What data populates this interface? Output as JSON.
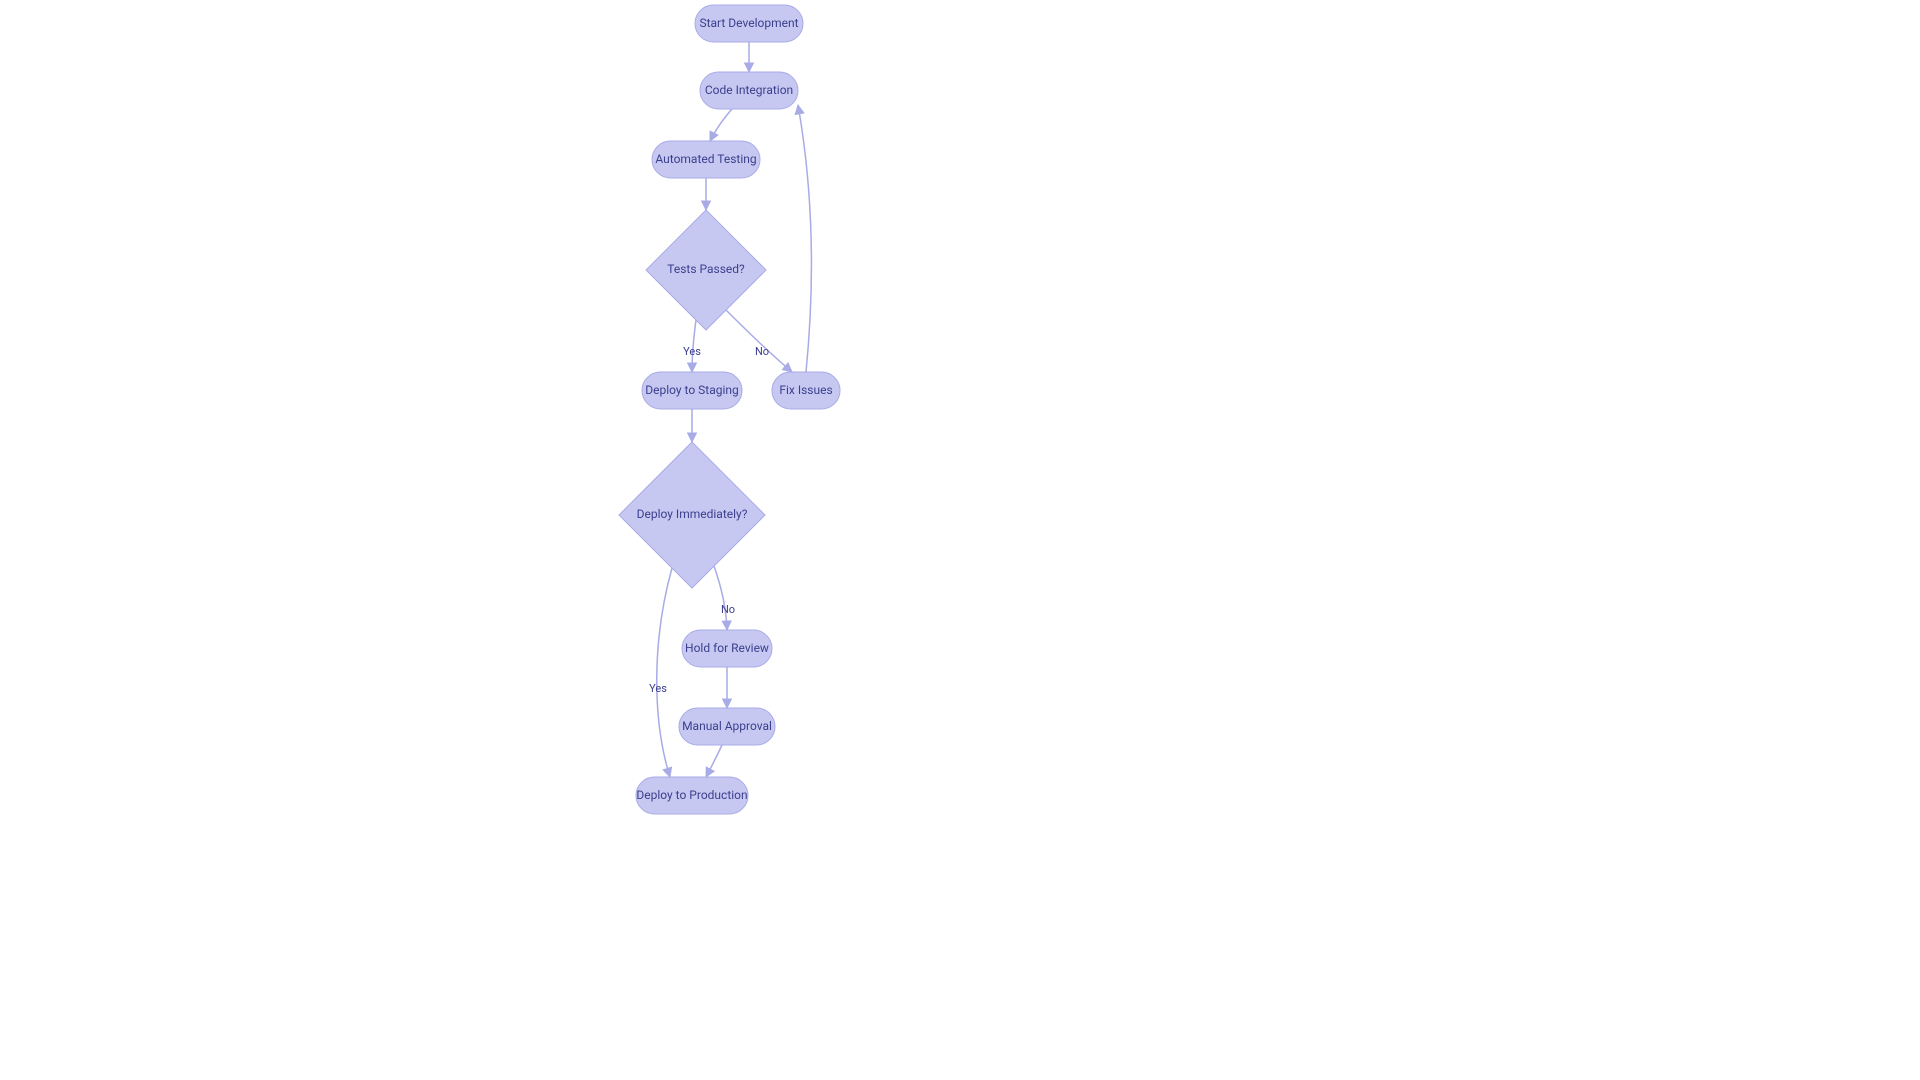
{
  "chart_data": {
    "type": "flowchart",
    "nodes": [
      {
        "id": "start",
        "label": "Start Development",
        "shape": "stadium"
      },
      {
        "id": "integ",
        "label": "Code Integration",
        "shape": "stadium"
      },
      {
        "id": "test",
        "label": "Automated Testing",
        "shape": "stadium"
      },
      {
        "id": "pass",
        "label": "Tests Passed?",
        "shape": "diamond"
      },
      {
        "id": "stage",
        "label": "Deploy to Staging",
        "shape": "stadium"
      },
      {
        "id": "fix",
        "label": "Fix Issues",
        "shape": "stadium"
      },
      {
        "id": "imm",
        "label": "Deploy Immediately?",
        "shape": "diamond"
      },
      {
        "id": "prod",
        "label": "Deploy to Production",
        "shape": "stadium"
      },
      {
        "id": "hold",
        "label": "Hold for Review",
        "shape": "stadium"
      },
      {
        "id": "appr",
        "label": "Manual Approval",
        "shape": "stadium"
      }
    ],
    "edges": [
      {
        "from": "start",
        "to": "integ"
      },
      {
        "from": "integ",
        "to": "test"
      },
      {
        "from": "test",
        "to": "pass"
      },
      {
        "from": "pass",
        "to": "stage",
        "label": "Yes"
      },
      {
        "from": "pass",
        "to": "fix",
        "label": "No"
      },
      {
        "from": "fix",
        "to": "integ"
      },
      {
        "from": "stage",
        "to": "imm"
      },
      {
        "from": "imm",
        "to": "prod",
        "label": "Yes"
      },
      {
        "from": "imm",
        "to": "hold",
        "label": "No"
      },
      {
        "from": "hold",
        "to": "appr"
      },
      {
        "from": "appr",
        "to": "prod"
      }
    ],
    "palette": {
      "node_fill": "#c7c8f2",
      "node_stroke": "#a9abe6",
      "text": "#3a3f8c",
      "edge": "#a9abe6",
      "bg": "#ffffff"
    }
  },
  "labels": {
    "start": "Start Development",
    "integ": "Code Integration",
    "test": "Automated Testing",
    "pass": "Tests Passed?",
    "stage": "Deploy to Staging",
    "fix": "Fix Issues",
    "imm": "Deploy Immediately?",
    "prod": "Deploy to Production",
    "hold": "Hold for Review",
    "appr": "Manual Approval",
    "yes": "Yes",
    "no": "No"
  }
}
